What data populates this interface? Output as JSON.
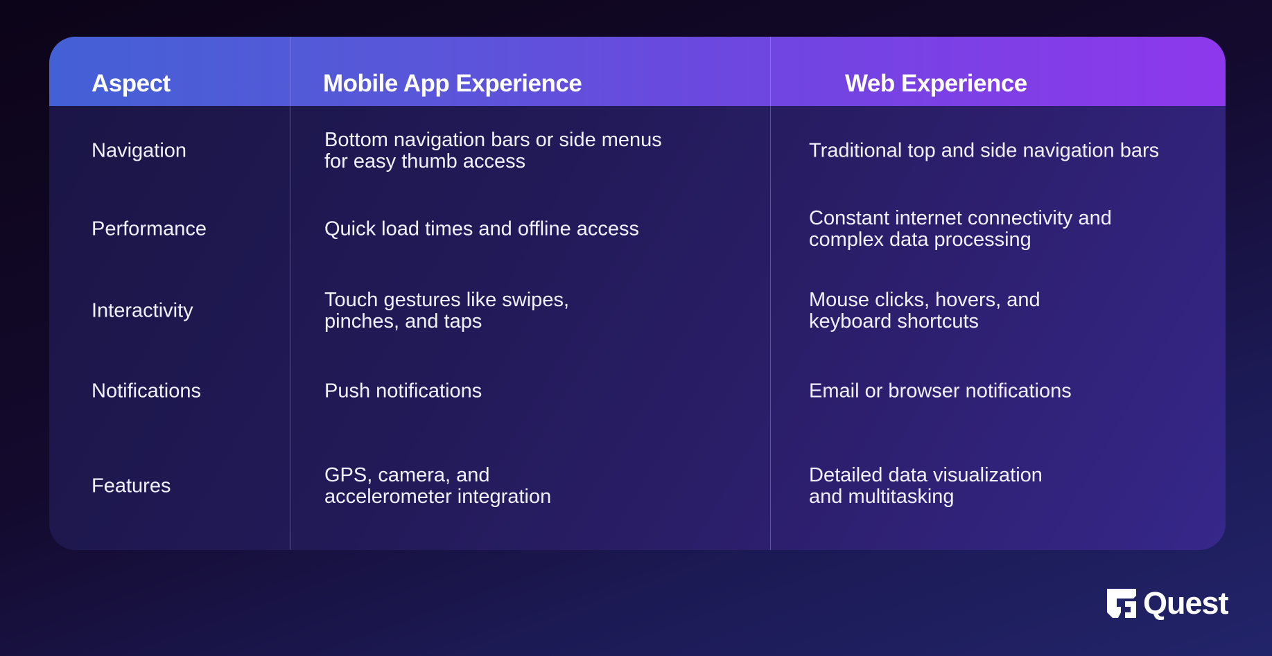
{
  "table": {
    "headers": [
      "Aspect",
      "Mobile App Experience",
      "Web Experience"
    ],
    "rows": [
      {
        "aspect": "Navigation",
        "mobile": [
          "Bottom navigation bars or side menus",
          "for easy thumb access"
        ],
        "web": [
          "Traditional top and side navigation bars"
        ]
      },
      {
        "aspect": "Performance",
        "mobile": [
          "Quick load times and offline access"
        ],
        "web": [
          "Constant internet connectivity and",
          "complex data processing"
        ]
      },
      {
        "aspect": "Interactivity",
        "mobile": [
          "Touch gestures like swipes,",
          "pinches, and taps"
        ],
        "web": [
          "Mouse clicks, hovers, and",
          "keyboard shortcuts"
        ]
      },
      {
        "aspect": "Notifications",
        "mobile": [
          "Push notifications"
        ],
        "web": [
          "Email or browser notifications"
        ]
      },
      {
        "aspect": "Features",
        "mobile": [
          "GPS, camera, and",
          "accelerometer integration"
        ],
        "web": [
          "Detailed data visualization",
          "and multitasking"
        ]
      }
    ]
  },
  "brand": {
    "logo_icon": "quest-logo-mark-icon",
    "name": "Quest"
  },
  "colors": {
    "header_gradient_start": "#4460d6",
    "header_gradient_end": "#8e38ec",
    "background_dark": "#0c0418",
    "background_light": "#22246a"
  }
}
